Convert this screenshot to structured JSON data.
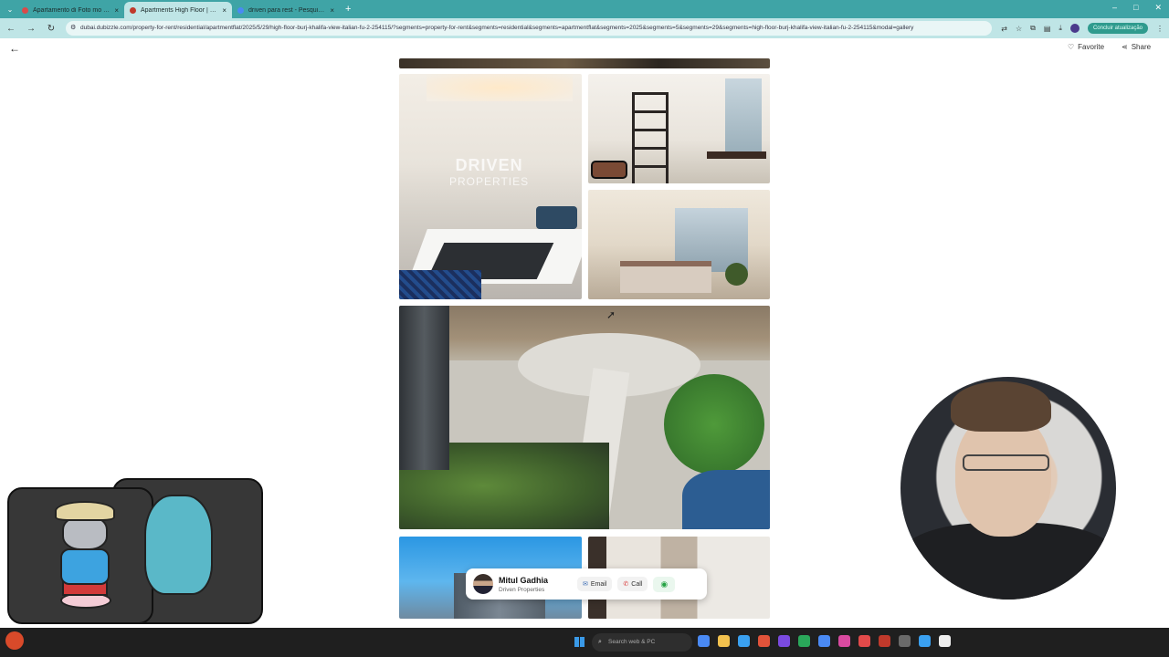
{
  "browser": {
    "tabs": [
      {
        "title": "Apartamento di Foto mo florid in",
        "favicon_color": "#d94a4a",
        "active": false
      },
      {
        "title": "Apartments High Floor | Burj K",
        "favicon_color": "#c0392b",
        "active": true
      },
      {
        "title": "driven para rest - Pesquisa no",
        "favicon_color": "#4a8af4",
        "active": false
      }
    ],
    "new_tab": "+",
    "url": "dubai.dubizzle.com/property-for-rent/residential/apartmentflat/2025/5/29/high-floor-burj-khalifa-view-italian-fu-2-254115/?segments=property-for-rent&segments=residential&segments=apartmentflat&segments=2025&segments=5&segments=29&segments=high-floor-burj-khalifa-view-italian-fu-2-254115&modal=gallery",
    "pill_button": "Concluir atualização"
  },
  "page": {
    "back_label": "←",
    "favorite_label": "Favorite",
    "share_label": "Share"
  },
  "gallery": {
    "watermark_line1": "DRIVEN",
    "watermark_line2": "PROPERTIES"
  },
  "agent": {
    "name": "Mitul Gadhia",
    "company": "Driven Properties",
    "email_label": "Email",
    "call_label": "Call"
  },
  "taskbar": {
    "search_placeholder": "Search web & PC",
    "app_colors": [
      "#4a8af4",
      "#f2c14e",
      "#3aa0f0",
      "#e2533a",
      "#7a4ae0",
      "#2aa75a",
      "#4a8af4",
      "#d94aa0",
      "#e24a4a",
      "#c0392b",
      "#6a6a6a",
      "#3aa0f0",
      "#eeeeee"
    ]
  }
}
